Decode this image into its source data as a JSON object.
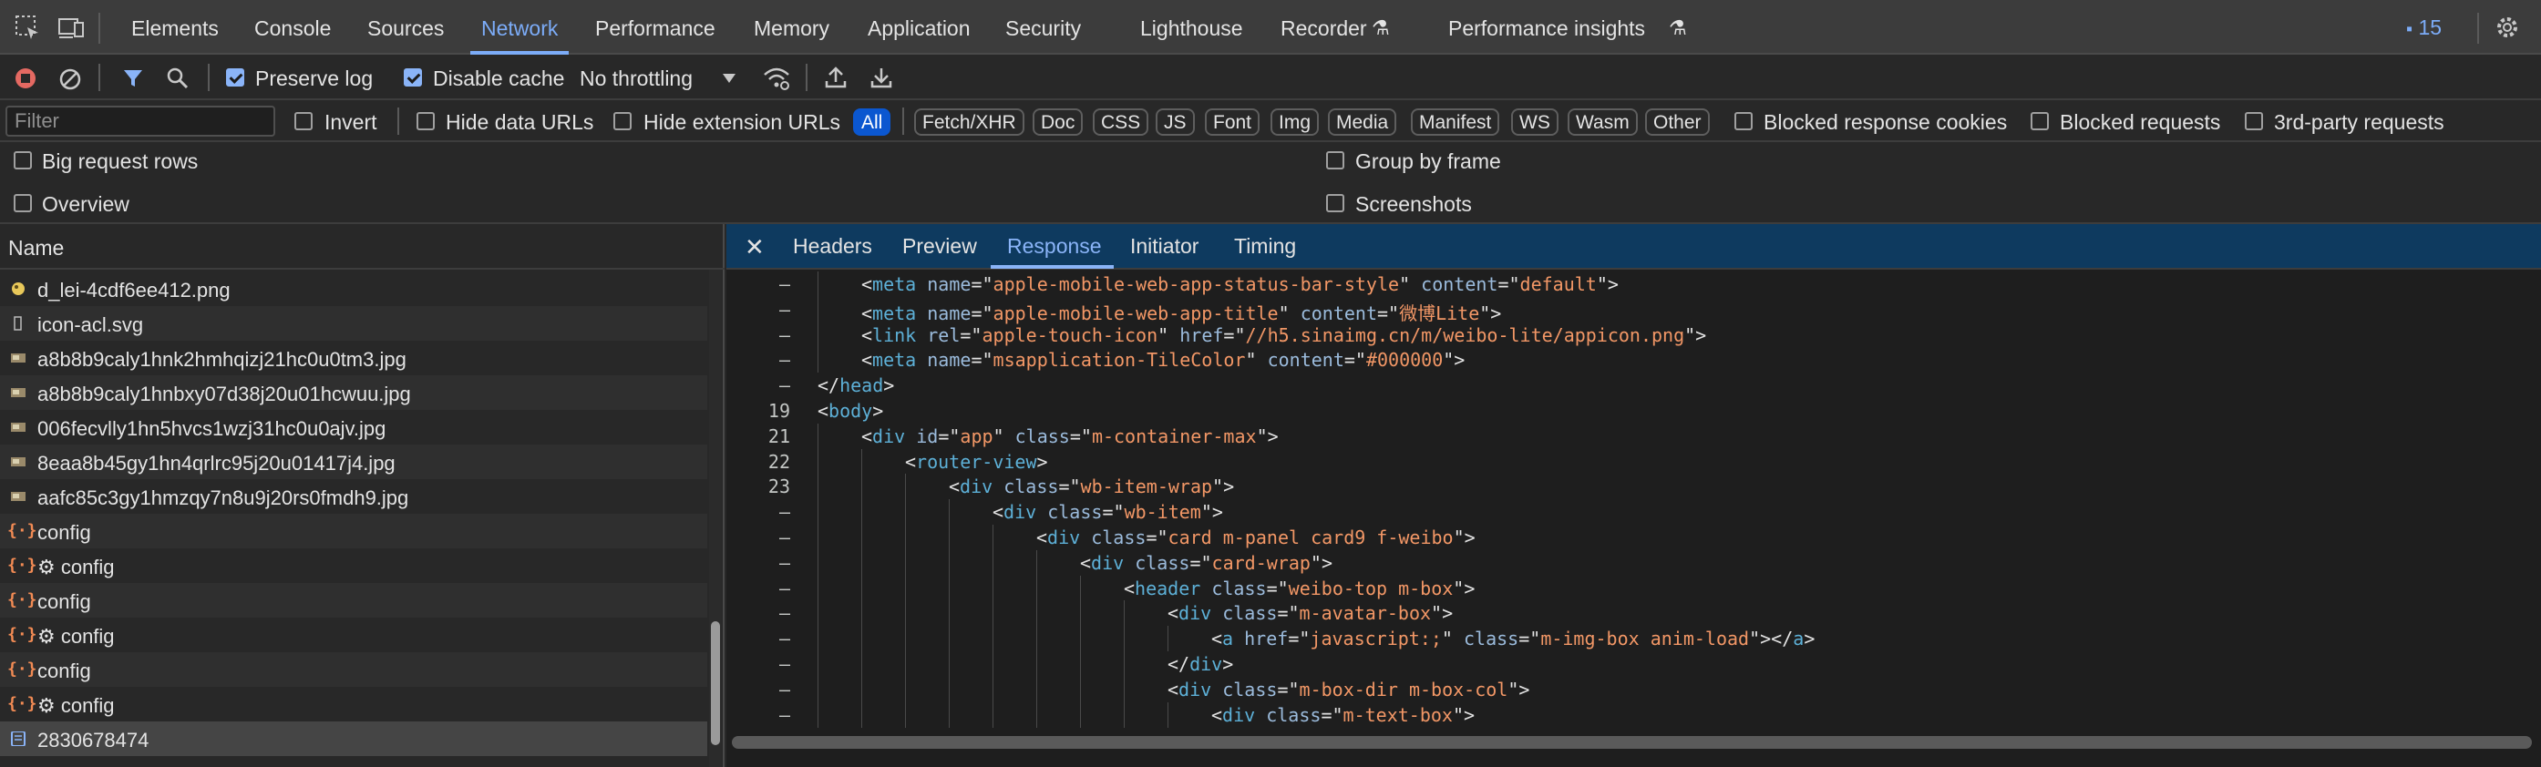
{
  "tabs": [
    "Elements",
    "Console",
    "Sources",
    "Network",
    "Performance",
    "Memory",
    "Application",
    "Security",
    "Lighthouse",
    "Recorder",
    "Performance insights"
  ],
  "active_tab": "Network",
  "issues_count": "15",
  "toolbar": {
    "preserve_log": "Preserve log",
    "disable_cache": "Disable cache",
    "throttling": "No throttling"
  },
  "filter": {
    "placeholder": "Filter",
    "invert": "Invert",
    "hide_data_urls": "Hide data URLs",
    "hide_extension_urls": "Hide extension URLs",
    "types": [
      "All",
      "Fetch/XHR",
      "Doc",
      "CSS",
      "JS",
      "Font",
      "Img",
      "Media",
      "Manifest",
      "WS",
      "Wasm",
      "Other"
    ],
    "blocked_response_cookies": "Blocked response cookies",
    "blocked_requests": "Blocked requests",
    "third_party": "3rd-party requests"
  },
  "options": {
    "big_rows": "Big request rows",
    "group_by_frame": "Group by frame",
    "overview": "Overview",
    "screenshots": "Screenshots"
  },
  "list": {
    "header": "Name",
    "rows": [
      {
        "name": "d_lei-4cdf6ee412.png",
        "icon": "png-image-icon"
      },
      {
        "name": "icon-acl.svg",
        "icon": "svg-file-icon"
      },
      {
        "name": "a8b8b9caly1hnk2hmhqizj21hc0u0tm3.jpg",
        "icon": "jpg-image-icon"
      },
      {
        "name": "a8b8b9caly1hnbxy07d38j20u01hcwuu.jpg",
        "icon": "jpg-image-icon"
      },
      {
        "name": "006fecvlly1hn5hvcs1wzj31hc0u0ajv.jpg",
        "icon": "jpg-image-icon"
      },
      {
        "name": "8eaa8b45gy1hn4qrlrc95j20u01417j4.jpg",
        "icon": "jpg-image-icon"
      },
      {
        "name": "aafc85c3gy1hmzqy7n8u9j20rs0fmdh9.jpg",
        "icon": "jpg-image-icon"
      },
      {
        "name": "config",
        "icon": "json-icon"
      },
      {
        "name": "⚙ config",
        "icon": "json-icon"
      },
      {
        "name": "config",
        "icon": "json-icon"
      },
      {
        "name": "⚙ config",
        "icon": "json-icon"
      },
      {
        "name": "config",
        "icon": "json-icon"
      },
      {
        "name": "⚙ config",
        "icon": "json-icon"
      },
      {
        "name": "2830678474",
        "icon": "document-icon"
      }
    ]
  },
  "detail_tabs": [
    "Headers",
    "Preview",
    "Response",
    "Initiator",
    "Timing"
  ],
  "active_detail_tab": "Response",
  "code_lines": [
    {
      "ln": "–",
      "indent": 2,
      "parts": [
        [
          "p",
          "<"
        ],
        [
          "t",
          "meta"
        ],
        [
          "p",
          " "
        ],
        [
          "a",
          "name"
        ],
        [
          "p",
          "=\""
        ],
        [
          "v",
          "apple-mobile-web-app-status-bar-style"
        ],
        [
          "p",
          "\" "
        ],
        [
          "a",
          "content"
        ],
        [
          "p",
          "=\""
        ],
        [
          "v",
          "default"
        ],
        [
          "p",
          "\">"
        ]
      ]
    },
    {
      "ln": "–",
      "indent": 2,
      "parts": [
        [
          "p",
          "<"
        ],
        [
          "t",
          "meta"
        ],
        [
          "p",
          " "
        ],
        [
          "a",
          "name"
        ],
        [
          "p",
          "=\""
        ],
        [
          "v",
          "apple-mobile-web-app-title"
        ],
        [
          "p",
          "\" "
        ],
        [
          "a",
          "content"
        ],
        [
          "p",
          "=\""
        ],
        [
          "v",
          "微博Lite"
        ],
        [
          "p",
          "\">"
        ]
      ]
    },
    {
      "ln": "–",
      "indent": 2,
      "parts": [
        [
          "p",
          "<"
        ],
        [
          "t",
          "link"
        ],
        [
          "p",
          " "
        ],
        [
          "a",
          "rel"
        ],
        [
          "p",
          "=\""
        ],
        [
          "v",
          "apple-touch-icon"
        ],
        [
          "p",
          "\" "
        ],
        [
          "a",
          "href"
        ],
        [
          "p",
          "=\""
        ],
        [
          "v",
          "//h5.sinaimg.cn/m/weibo-lite/appicon.png"
        ],
        [
          "p",
          "\">"
        ]
      ]
    },
    {
      "ln": "–",
      "indent": 2,
      "parts": [
        [
          "p",
          "<"
        ],
        [
          "t",
          "meta"
        ],
        [
          "p",
          " "
        ],
        [
          "a",
          "name"
        ],
        [
          "p",
          "=\""
        ],
        [
          "v",
          "msapplication-TileColor"
        ],
        [
          "p",
          "\" "
        ],
        [
          "a",
          "content"
        ],
        [
          "p",
          "=\""
        ],
        [
          "v",
          "#000000"
        ],
        [
          "p",
          "\">"
        ]
      ]
    },
    {
      "ln": "–",
      "indent": 1,
      "parts": [
        [
          "p",
          "</"
        ],
        [
          "t",
          "head"
        ],
        [
          "p",
          ">"
        ]
      ]
    },
    {
      "ln": "19",
      "indent": 1,
      "parts": [
        [
          "p",
          "<"
        ],
        [
          "t",
          "body"
        ],
        [
          "p",
          ">"
        ]
      ]
    },
    {
      "ln": "21",
      "indent": 2,
      "parts": [
        [
          "p",
          "<"
        ],
        [
          "t",
          "div"
        ],
        [
          "p",
          " "
        ],
        [
          "a",
          "id"
        ],
        [
          "p",
          "=\""
        ],
        [
          "v",
          "app"
        ],
        [
          "p",
          "\" "
        ],
        [
          "a",
          "class"
        ],
        [
          "p",
          "=\""
        ],
        [
          "v",
          "m-container-max"
        ],
        [
          "p",
          "\">"
        ]
      ]
    },
    {
      "ln": "22",
      "indent": 3,
      "parts": [
        [
          "p",
          "<"
        ],
        [
          "t",
          "router-view"
        ],
        [
          "p",
          ">"
        ]
      ]
    },
    {
      "ln": "23",
      "indent": 4,
      "parts": [
        [
          "p",
          "<"
        ],
        [
          "t",
          "div"
        ],
        [
          "p",
          " "
        ],
        [
          "a",
          "class"
        ],
        [
          "p",
          "=\""
        ],
        [
          "v",
          "wb-item-wrap"
        ],
        [
          "p",
          "\">"
        ]
      ]
    },
    {
      "ln": "–",
      "indent": 5,
      "parts": [
        [
          "p",
          "<"
        ],
        [
          "t",
          "div"
        ],
        [
          "p",
          " "
        ],
        [
          "a",
          "class"
        ],
        [
          "p",
          "=\""
        ],
        [
          "v",
          "wb-item"
        ],
        [
          "p",
          "\">"
        ]
      ]
    },
    {
      "ln": "–",
      "indent": 6,
      "parts": [
        [
          "p",
          "<"
        ],
        [
          "t",
          "div"
        ],
        [
          "p",
          " "
        ],
        [
          "a",
          "class"
        ],
        [
          "p",
          "=\""
        ],
        [
          "v",
          "card m-panel card9 f-weibo"
        ],
        [
          "p",
          "\">"
        ]
      ]
    },
    {
      "ln": "–",
      "indent": 7,
      "parts": [
        [
          "p",
          "<"
        ],
        [
          "t",
          "div"
        ],
        [
          "p",
          " "
        ],
        [
          "a",
          "class"
        ],
        [
          "p",
          "=\""
        ],
        [
          "v",
          "card-wrap"
        ],
        [
          "p",
          "\">"
        ]
      ]
    },
    {
      "ln": "–",
      "indent": 8,
      "parts": [
        [
          "p",
          "<"
        ],
        [
          "t",
          "header"
        ],
        [
          "p",
          " "
        ],
        [
          "a",
          "class"
        ],
        [
          "p",
          "=\""
        ],
        [
          "v",
          "weibo-top m-box"
        ],
        [
          "p",
          "\">"
        ]
      ]
    },
    {
      "ln": "–",
      "indent": 9,
      "parts": [
        [
          "p",
          "<"
        ],
        [
          "t",
          "div"
        ],
        [
          "p",
          " "
        ],
        [
          "a",
          "class"
        ],
        [
          "p",
          "=\""
        ],
        [
          "v",
          "m-avatar-box"
        ],
        [
          "p",
          "\">"
        ]
      ]
    },
    {
      "ln": "–",
      "indent": 10,
      "parts": [
        [
          "p",
          "<"
        ],
        [
          "t",
          "a"
        ],
        [
          "p",
          " "
        ],
        [
          "a",
          "href"
        ],
        [
          "p",
          "=\""
        ],
        [
          "v",
          "javascript:;"
        ],
        [
          "p",
          "\" "
        ],
        [
          "a",
          "class"
        ],
        [
          "p",
          "=\""
        ],
        [
          "v",
          "m-img-box anim-load"
        ],
        [
          "p",
          "\"></"
        ],
        [
          "t",
          "a"
        ],
        [
          "p",
          ">"
        ]
      ]
    },
    {
      "ln": "–",
      "indent": 9,
      "parts": [
        [
          "p",
          "</"
        ],
        [
          "t",
          "div"
        ],
        [
          "p",
          ">"
        ]
      ]
    },
    {
      "ln": "–",
      "indent": 9,
      "parts": [
        [
          "p",
          "<"
        ],
        [
          "t",
          "div"
        ],
        [
          "p",
          " "
        ],
        [
          "a",
          "class"
        ],
        [
          "p",
          "=\""
        ],
        [
          "v",
          "m-box-dir m-box-col"
        ],
        [
          "p",
          "\">"
        ]
      ]
    },
    {
      "ln": "–",
      "indent": 10,
      "parts": [
        [
          "p",
          "<"
        ],
        [
          "t",
          "div"
        ],
        [
          "p",
          " "
        ],
        [
          "a",
          "class"
        ],
        [
          "p",
          "=\""
        ],
        [
          "v",
          "m-text-box"
        ],
        [
          "p",
          "\">"
        ]
      ]
    }
  ]
}
